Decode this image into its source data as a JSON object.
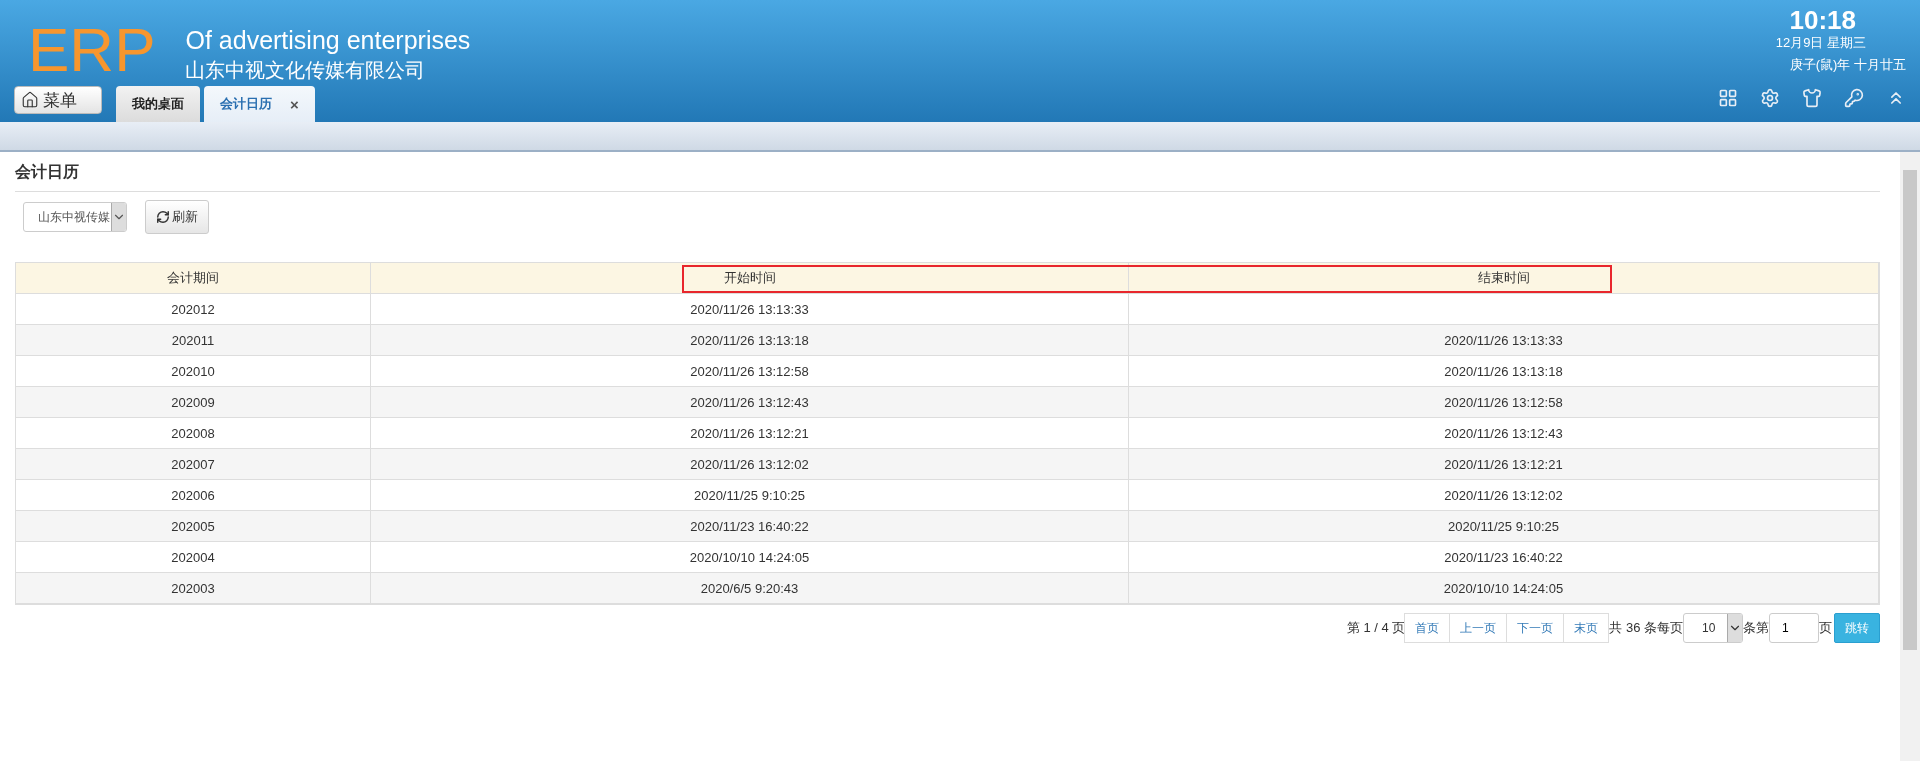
{
  "header": {
    "logo": "ERP",
    "subtitle": "Of advertising enterprises",
    "company": "山东中视文化传媒有限公司",
    "time": "10:18",
    "date": "12月9日 星期三",
    "lunar": "庚子(鼠)年 十月廿五"
  },
  "menu_button": "菜单",
  "tabs": [
    {
      "label": "我的桌面",
      "selected": false
    },
    {
      "label": "会计日历",
      "selected": true,
      "close": "×"
    }
  ],
  "page_title": "会计日历",
  "company_select": {
    "value": "山东中视传媒"
  },
  "refresh_button": "刷新",
  "table": {
    "columns": [
      "会计期间",
      "开始时间",
      "结束时间"
    ],
    "rows": [
      [
        "202012",
        "2020/11/26 13:13:33",
        ""
      ],
      [
        "202011",
        "2020/11/26 13:13:18",
        "2020/11/26 13:13:33"
      ],
      [
        "202010",
        "2020/11/26 13:12:58",
        "2020/11/26 13:13:18"
      ],
      [
        "202009",
        "2020/11/26 13:12:43",
        "2020/11/26 13:12:58"
      ],
      [
        "202008",
        "2020/11/26 13:12:21",
        "2020/11/26 13:12:43"
      ],
      [
        "202007",
        "2020/11/26 13:12:02",
        "2020/11/26 13:12:21"
      ],
      [
        "202006",
        "2020/11/25 9:10:25",
        "2020/11/26 13:12:02"
      ],
      [
        "202005",
        "2020/11/23 16:40:22",
        "2020/11/25 9:10:25"
      ],
      [
        "202004",
        "2020/10/10 14:24:05",
        "2020/11/23 16:40:22"
      ],
      [
        "202003",
        "2020/6/5 9:20:43",
        "2020/10/10 14:24:05"
      ]
    ]
  },
  "pagination": {
    "page_info": "第 1 / 4 页",
    "buttons": [
      "首页",
      "上一页",
      "下一页",
      "末页"
    ],
    "total": "共 36 条每页",
    "page_size": "10",
    "goto_prefix": "条第",
    "goto_value": "1",
    "goto_suffix": "页",
    "jump": "跳转"
  }
}
